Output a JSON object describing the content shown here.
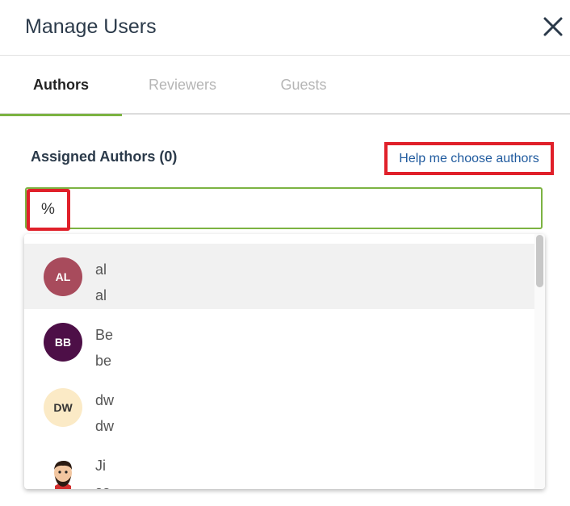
{
  "dialog": {
    "title": "Manage Users",
    "close_icon": "close-icon"
  },
  "tabs": [
    {
      "label": "Authors",
      "active": true
    },
    {
      "label": "Reviewers",
      "active": false
    },
    {
      "label": "Guests",
      "active": false
    }
  ],
  "section": {
    "label": "Assigned Authors (0)",
    "help_link": "Help me choose authors"
  },
  "search": {
    "value": "%"
  },
  "results": [
    {
      "initials": "AL",
      "name": "al",
      "detail": "al",
      "avatar_color": "#a84b5c",
      "highlighted": true
    },
    {
      "initials": "BB",
      "name": "Be",
      "detail": "be",
      "avatar_color": "#4d0f47",
      "highlighted": false
    },
    {
      "initials": "DW",
      "name": "dw",
      "detail": "dw",
      "avatar_color": "#fbeac6",
      "highlighted": false
    },
    {
      "initials": "",
      "name": "Ji",
      "detail": "sa",
      "avatar_icon": "user-photo-avatar",
      "highlighted": false
    }
  ],
  "colors": {
    "accent": "#7cb342",
    "link": "#1f5a9e",
    "annotation": "#e0202a"
  }
}
